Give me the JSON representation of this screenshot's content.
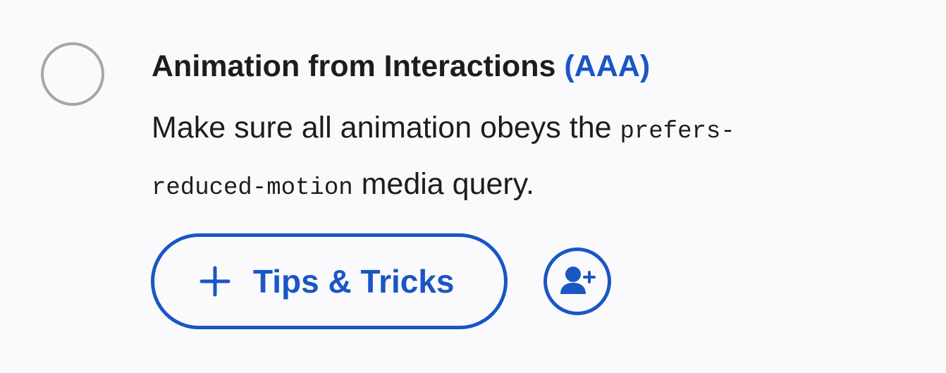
{
  "item": {
    "title": "Animation from Interactions",
    "level": "(AAA)",
    "description_before": "Make sure all animation obeys the ",
    "description_code": "prefers-reduced-motion",
    "description_after": " media query.",
    "tips_button_label": "Tips & Tricks",
    "icons": {
      "checkbox": "empty-circle-checkbox-icon",
      "tips": "plus-icon",
      "assign": "add-user-icon"
    }
  },
  "colors": {
    "accent": "#1a56c4",
    "text": "#1d1d1f",
    "checkbox_border": "#a6a6a6",
    "background": "#fafafc"
  }
}
